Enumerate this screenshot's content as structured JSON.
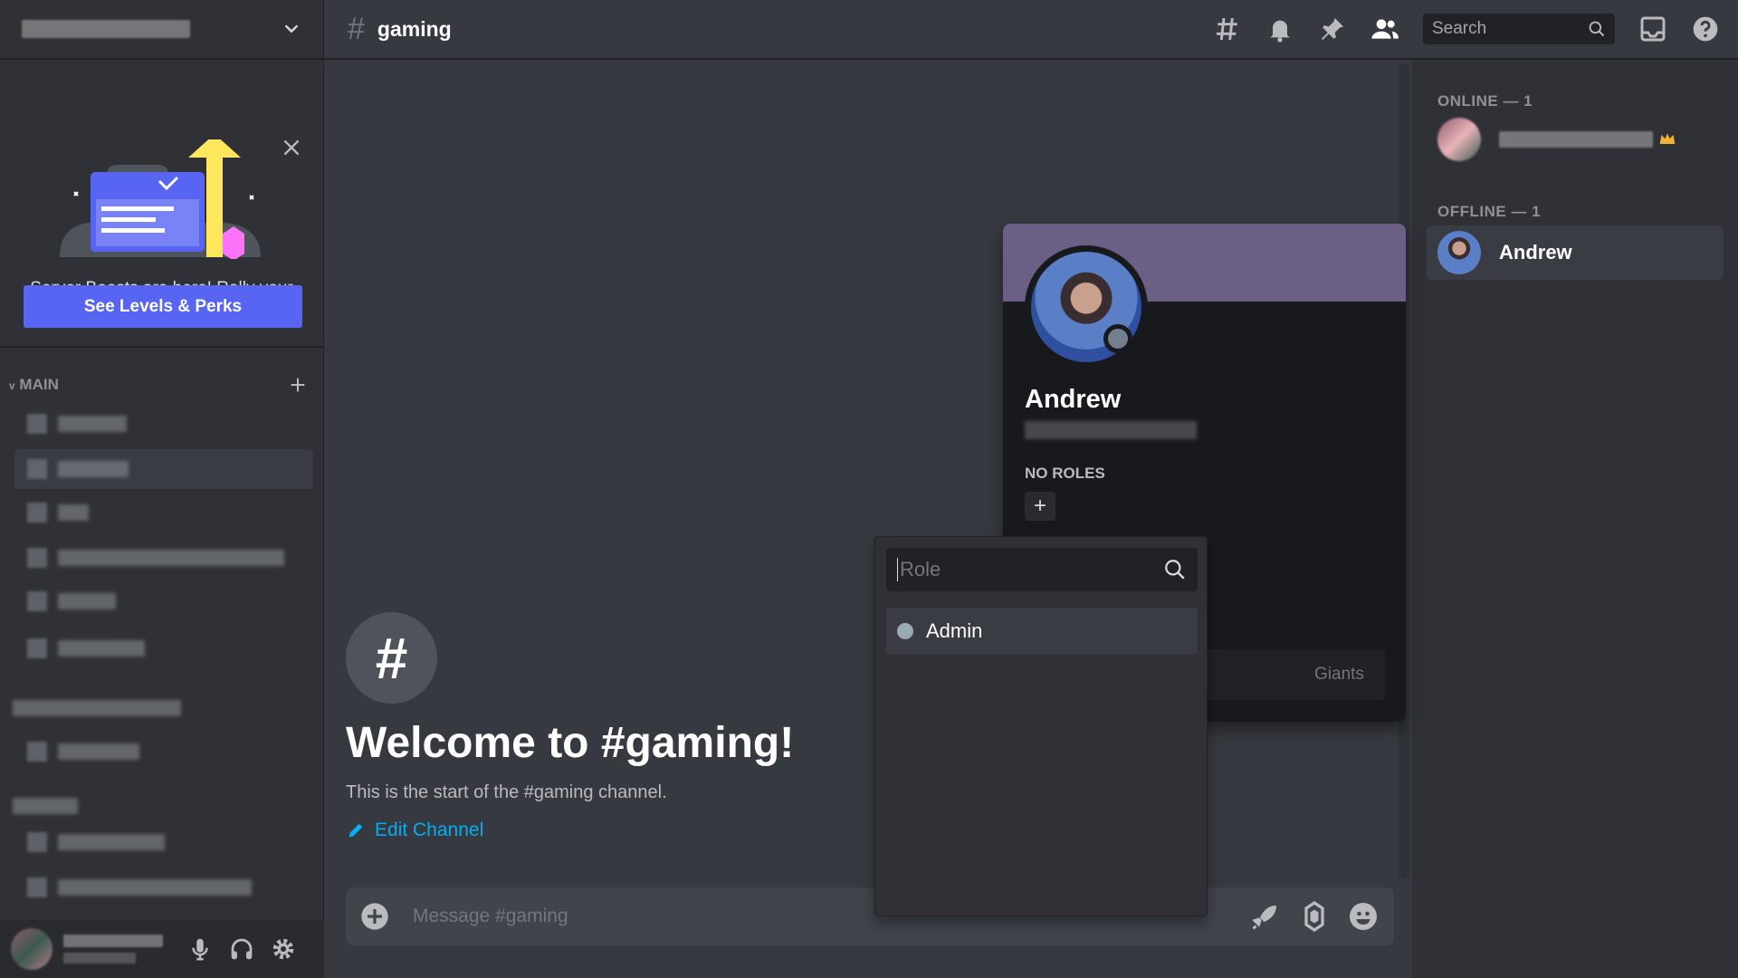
{
  "channel": {
    "name": "gaming",
    "hash": "#"
  },
  "toolbar": {
    "search_placeholder": "Search"
  },
  "boost": {
    "text": "Server Boosts are here! Rally your friends to Boost your server.",
    "button": "See Levels & Perks"
  },
  "sidebar": {
    "category": "MAIN"
  },
  "welcome": {
    "title": "Welcome to #gaming!",
    "subtitle": "This is the start of the #gaming channel.",
    "edit": "Edit Channel"
  },
  "composer": {
    "placeholder": "Message #gaming"
  },
  "members": {
    "online_header": "ONLINE — 1",
    "offline_header": "OFFLINE — 1",
    "offline": [
      {
        "name": "Andrew"
      }
    ]
  },
  "profile": {
    "name": "Andrew",
    "roles_header": "NO ROLES",
    "note_text": "Giants"
  },
  "role_picker": {
    "placeholder": "Role",
    "roles": [
      {
        "name": "Admin",
        "color": "#99aab5"
      }
    ]
  },
  "colors": {
    "accent": "#5865f2",
    "link": "#00aff4",
    "banner": "#6c5f85",
    "crown": "#f0b232"
  }
}
